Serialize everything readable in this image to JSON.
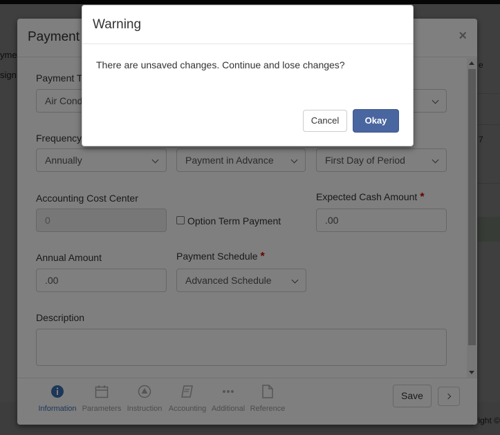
{
  "background": {
    "left_texts": [
      "yme",
      "sign"
    ],
    "right_texts": [
      "e",
      "7"
    ],
    "copyright": "yright ©"
  },
  "payment_modal": {
    "title": "Payment",
    "close_glyph": "×",
    "fields": {
      "payment_type_label": "Payment T",
      "payment_type_value": "Air Cond",
      "frequency_label": "Frequency",
      "frequency_value": "Annually",
      "timing_value": "Payment in Advance",
      "due_day_value": "First Day of Period",
      "cost_center_label": "Accounting Cost Center",
      "cost_center_placeholder": "0",
      "option_term_label": "Option Term Payment",
      "expected_cash_label": "Expected Cash Amount",
      "expected_cash_value": ".00",
      "annual_amount_label": "Annual Amount",
      "annual_amount_value": ".00",
      "payment_schedule_label": "Payment Schedule",
      "payment_schedule_value": "Advanced Schedule",
      "description_label": "Description",
      "required_mark": "*"
    },
    "footer_tabs": [
      {
        "label": "Information",
        "icon": "info-icon",
        "active": true
      },
      {
        "label": "Parameters",
        "icon": "calendar-icon",
        "active": false
      },
      {
        "label": "Instruction",
        "icon": "triangle-circle-icon",
        "active": false
      },
      {
        "label": "Accounting",
        "icon": "book-icon",
        "active": false
      },
      {
        "label": "Additional",
        "icon": "ellipsis-icon",
        "active": false
      },
      {
        "label": "Reference",
        "icon": "document-icon",
        "active": false
      }
    ],
    "save_label": "Save"
  },
  "warning_dialog": {
    "title": "Warning",
    "message": "There are unsaved changes. Continue and lose changes?",
    "cancel_label": "Cancel",
    "okay_label": "Okay"
  },
  "colors": {
    "primary_button": "#4a66a0",
    "active_tab": "#3a6fb0",
    "required": "#cc0000"
  }
}
